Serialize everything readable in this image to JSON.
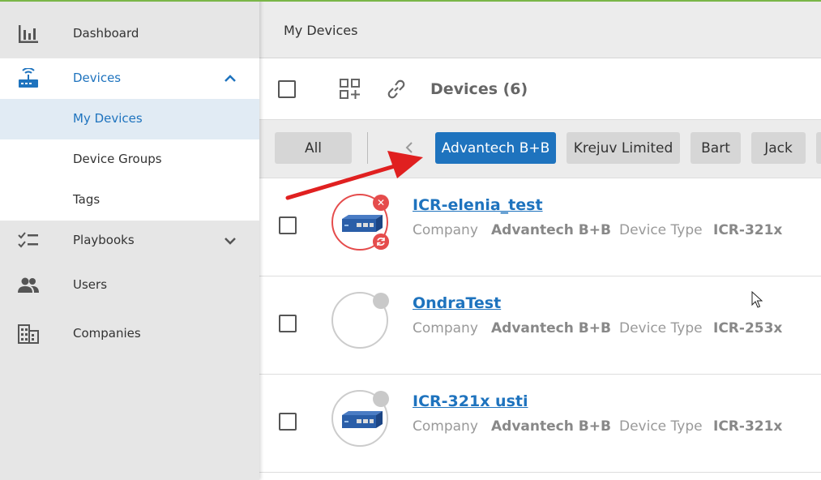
{
  "sidebar": {
    "dashboard": "Dashboard",
    "devices": "Devices",
    "my_devices": "My Devices",
    "device_groups": "Device Groups",
    "tags": "Tags",
    "playbooks": "Playbooks",
    "users": "Users",
    "companies": "Companies"
  },
  "header": {
    "title": "My Devices"
  },
  "toolbar": {
    "count_label": "Devices (6)"
  },
  "filters": {
    "all": "All",
    "chips": [
      "Advantech B+B",
      "Krejuv Limited",
      "Bart",
      "Jack"
    ],
    "active": "Advantech B+B"
  },
  "labels": {
    "company": "Company",
    "device_type": "Device Type"
  },
  "devices": [
    {
      "name": "ICR-elenia_test",
      "company": "Advantech B+B",
      "type": "ICR-321x",
      "status": "error"
    },
    {
      "name": "OndraTest",
      "company": "Advantech B+B",
      "type": "ICR-253x",
      "status": "offline"
    },
    {
      "name": "ICR-321x usti",
      "company": "Advantech B+B",
      "type": "ICR-321x",
      "status": "offline"
    }
  ],
  "colors": {
    "accent": "#1e73be",
    "alert": "#e54c4c",
    "annotation_arrow": "#e02020"
  }
}
